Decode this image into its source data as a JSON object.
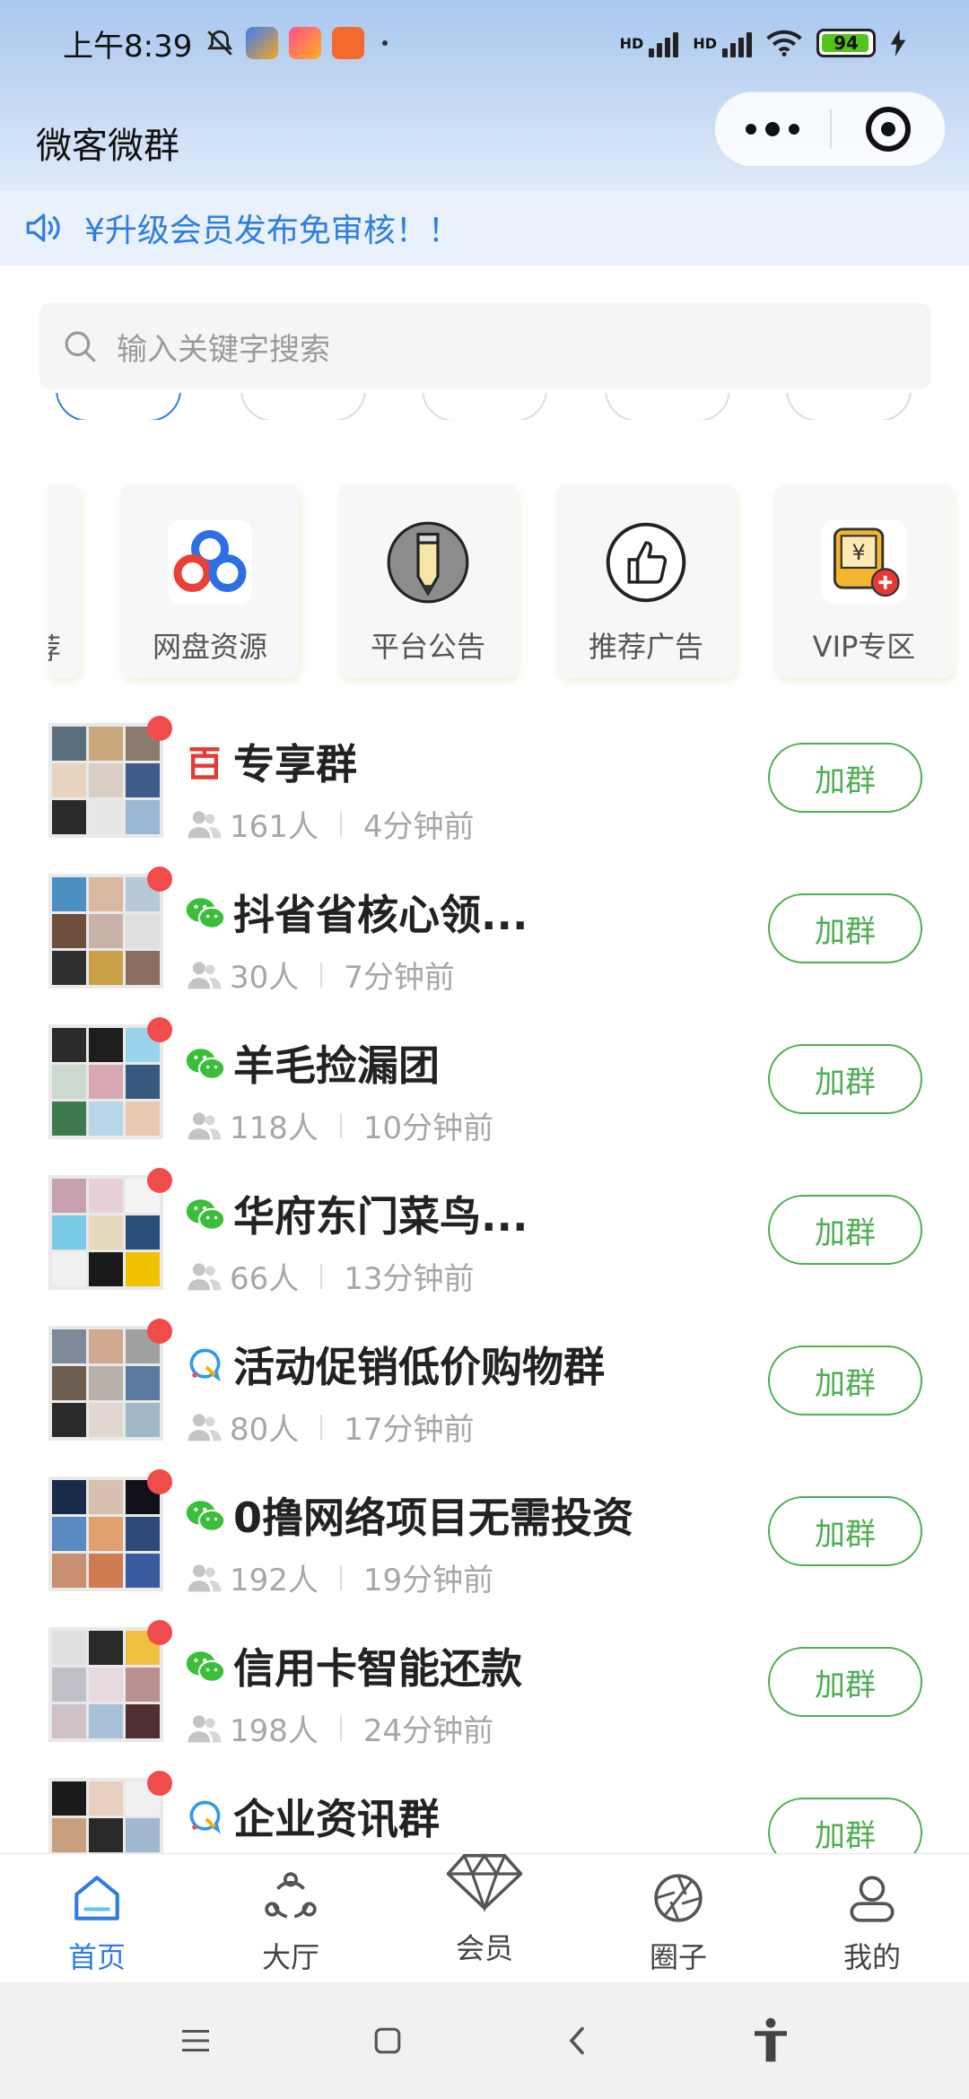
{
  "status_bar": {
    "time": "上午8:39",
    "battery": "94",
    "hd1": "HD",
    "hd2": "HD"
  },
  "app": {
    "title": "微客微群"
  },
  "notice": {
    "text": "¥升级会员发布免审核！！"
  },
  "search": {
    "placeholder": "输入关键字搜索"
  },
  "categories": [
    {
      "label": "网盘资源",
      "icon": "cloud-drive-icon"
    },
    {
      "label": "平台公告",
      "icon": "pencil-icon"
    },
    {
      "label": "推荐广告",
      "icon": "thumbs-up-icon"
    },
    {
      "label": "VIP专区",
      "icon": "vip-card-icon"
    }
  ],
  "cut_category_fragment": "荐",
  "groups": [
    {
      "name": "专享群",
      "members": "161人",
      "time": "4分钟前",
      "platform": "baidu",
      "action": "加群"
    },
    {
      "name": "抖省省核心领...",
      "members": "30人",
      "time": "7分钟前",
      "platform": "wechat",
      "action": "加群"
    },
    {
      "name": "羊毛捡漏团",
      "members": "118人",
      "time": "10分钟前",
      "platform": "wechat",
      "action": "加群"
    },
    {
      "name": "华府东门菜鸟...",
      "members": "66人",
      "time": "13分钟前",
      "platform": "wechat",
      "action": "加群"
    },
    {
      "name": "活动促销低价购物群",
      "members": "80人",
      "time": "17分钟前",
      "platform": "qq",
      "action": "加群"
    },
    {
      "name": "0撸网络项目无需投资",
      "members": "192人",
      "time": "19分钟前",
      "platform": "wechat",
      "action": "加群"
    },
    {
      "name": "信用卡智能还款",
      "members": "198人",
      "time": "24分钟前",
      "platform": "wechat",
      "action": "加群"
    },
    {
      "name": "企业资讯群",
      "members": "",
      "time": "",
      "platform": "qq",
      "action": "加群"
    }
  ],
  "tabbar": [
    {
      "label": "首页",
      "icon": "home-icon",
      "active": true
    },
    {
      "label": "大厅",
      "icon": "hall-icon",
      "active": false
    },
    {
      "label": "会员",
      "icon": "diamond-icon",
      "active": false
    },
    {
      "label": "圈子",
      "icon": "aperture-icon",
      "active": false
    },
    {
      "label": "我的",
      "icon": "profile-icon",
      "active": false
    }
  ],
  "colors": {
    "accent_blue": "#2f7de0",
    "accent_green": "#4caf50",
    "badge_red": "#f14c4c"
  }
}
